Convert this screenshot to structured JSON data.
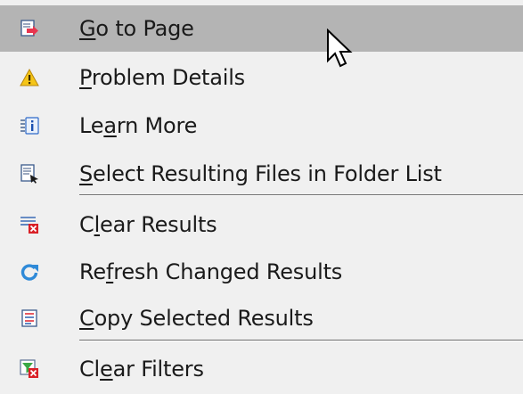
{
  "menu": {
    "items": [
      {
        "pre": "",
        "mnemonic": "G",
        "post": "o to Page",
        "icon": "go-to-page-icon",
        "hovered": true
      },
      {
        "pre": "",
        "mnemonic": "P",
        "post": "roblem Details",
        "icon": "warning-icon"
      },
      {
        "pre": "Le",
        "mnemonic": "a",
        "post": "rn More",
        "icon": "info-icon"
      },
      {
        "pre": "",
        "mnemonic": "S",
        "post": "elect Resulting Files in Folder List",
        "icon": "select-files-icon"
      },
      {
        "pre": "C",
        "mnemonic": "l",
        "post": "ear Results",
        "icon": "clear-results-icon"
      },
      {
        "pre": "Re",
        "mnemonic": "f",
        "post": "resh Changed Results",
        "icon": "refresh-icon"
      },
      {
        "pre": "",
        "mnemonic": "C",
        "post": "opy Selected Results",
        "icon": "copy-results-icon"
      },
      {
        "pre": "Cl",
        "mnemonic": "e",
        "post": "ar Filters",
        "icon": "clear-filters-icon"
      }
    ]
  },
  "colors": {
    "menu_background": "#f0f0f0",
    "hover_background": "#b4b4b4",
    "text": "#1a1a1a",
    "separator": "#6d6d6d"
  }
}
